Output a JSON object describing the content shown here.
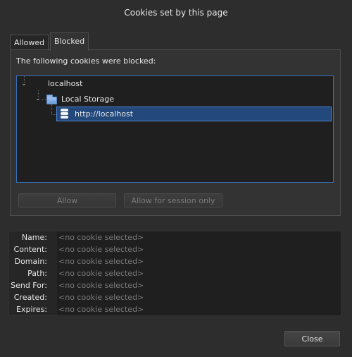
{
  "dialog": {
    "title": "Cookies set by this page"
  },
  "tabs": [
    {
      "label": "Allowed",
      "selected": false
    },
    {
      "label": "Blocked",
      "selected": true
    }
  ],
  "blocked_panel": {
    "caption": "The following cookies were blocked:",
    "tree": {
      "site": "localhost",
      "folder": "Local Storage",
      "entry": "http://localhost"
    },
    "buttons": {
      "allow": "Allow",
      "allow_session": "Allow for session only"
    }
  },
  "details": {
    "rows": [
      {
        "label": "Name:",
        "value": "<no cookie selected>"
      },
      {
        "label": "Content:",
        "value": "<no cookie selected>"
      },
      {
        "label": "Domain:",
        "value": "<no cookie selected>"
      },
      {
        "label": "Path:",
        "value": "<no cookie selected>"
      },
      {
        "label": "Send For:",
        "value": "<no cookie selected>"
      },
      {
        "label": "Created:",
        "value": "<no cookie selected>"
      },
      {
        "label": "Expires:",
        "value": "<no cookie selected>"
      }
    ]
  },
  "footer": {
    "close_label": "Close"
  },
  "colors": {
    "background": "#2d2d2d",
    "selection": "#22487c",
    "focus_border": "#3d6fb7"
  },
  "icons": {
    "expander": "chevron-down-icon",
    "folder": "folder-icon",
    "storage": "database-icon"
  }
}
